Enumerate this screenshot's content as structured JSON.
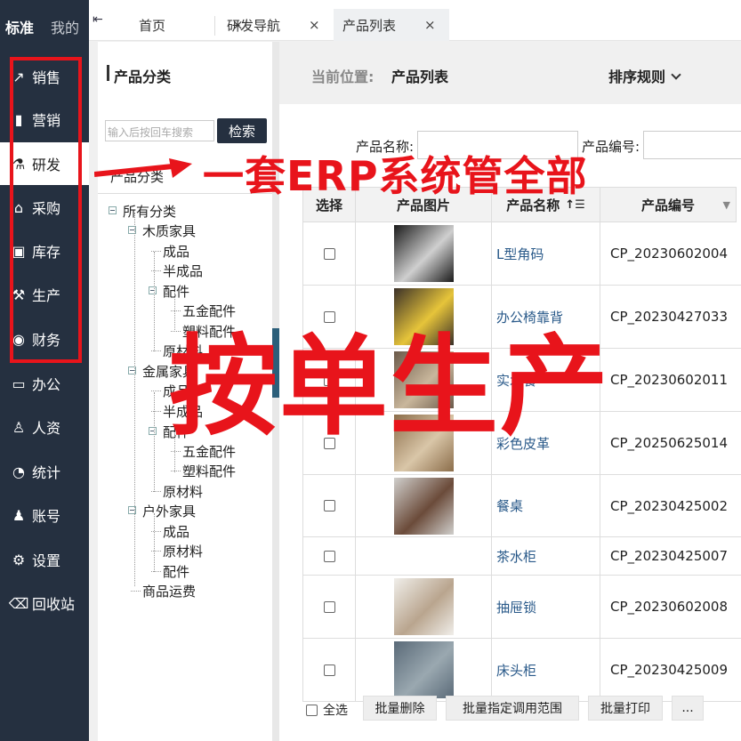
{
  "nav": {
    "tabs": [
      "标准",
      "我的"
    ],
    "items": [
      {
        "label": "销售",
        "icon": "chart-up-icon"
      },
      {
        "label": "营销",
        "icon": "bar-chart-icon"
      },
      {
        "label": "研发",
        "icon": "flask-icon"
      },
      {
        "label": "采购",
        "icon": "cart-icon"
      },
      {
        "label": "库存",
        "icon": "box-icon"
      },
      {
        "label": "生产",
        "icon": "factory-icon"
      },
      {
        "label": "财务",
        "icon": "money-icon"
      },
      {
        "label": "办公",
        "icon": "briefcase-icon"
      },
      {
        "label": "人资",
        "icon": "person-icon"
      },
      {
        "label": "统计",
        "icon": "pie-icon"
      },
      {
        "label": "账号",
        "icon": "user-icon"
      },
      {
        "label": "设置",
        "icon": "gear-icon"
      },
      {
        "label": "回收站",
        "icon": "trash-icon"
      }
    ],
    "active_index": 2
  },
  "tabs": [
    {
      "label": "首页"
    },
    {
      "label": "研发导航"
    },
    {
      "label": "产品列表"
    }
  ],
  "category": {
    "title": "产品分类",
    "search_placeholder": "输入后按回车搜索",
    "search_button": "检索",
    "header": "产品分类",
    "tree": {
      "root": "所有分类",
      "n1": "木质家具",
      "n1a": "成品",
      "n1b": "半成品",
      "n1c": "配件",
      "n1c1": "五金配件",
      "n1c2": "塑料配件",
      "n1d": "原材料",
      "n2": "金属家具",
      "n2a": "成品",
      "n2b": "半成品",
      "n2c": "配件",
      "n2c1": "五金配件",
      "n2c2": "塑料配件",
      "n2d": "原材料",
      "n3": "户外家具",
      "n3a": "成品",
      "n3b": "原材料",
      "n3c": "配件",
      "n4": "商品运费"
    }
  },
  "main": {
    "crumb_label": "当前位置:",
    "crumb_value": "产品列表",
    "sort_label": "排序规则",
    "filter_name_label": "产品名称:",
    "filter_code_label": "产品编号:",
    "columns": [
      "选择",
      "产品图片",
      "产品名称",
      "产品编号"
    ],
    "rows": [
      {
        "name": "L型角码",
        "code": "CP_20230602004"
      },
      {
        "name": "办公椅靠背",
        "code": "CP_20230427033"
      },
      {
        "name": "实木餐",
        "code": "CP_20230602011"
      },
      {
        "name": "彩色皮革",
        "code": "CP_20250625014"
      },
      {
        "name": "餐桌",
        "code": "CP_20230425002"
      },
      {
        "name": "茶水柜",
        "code": "CP_20230425007"
      },
      {
        "name": "抽屉锁",
        "code": "CP_20230602008"
      },
      {
        "name": "床头柜",
        "code": "CP_20230425009"
      }
    ],
    "select_all": "全选",
    "btn_delete": "批量删除",
    "btn_scope": "批量指定调用范围",
    "btn_print": "批量打印",
    "btn_more": "..."
  },
  "overlays": {
    "banner_top": "一套ERP系统管全部",
    "banner_mid": "按单生产"
  },
  "colors": {
    "accent_red": "#e8141b",
    "nav_bg": "#253040",
    "link": "#2a5a8a"
  }
}
